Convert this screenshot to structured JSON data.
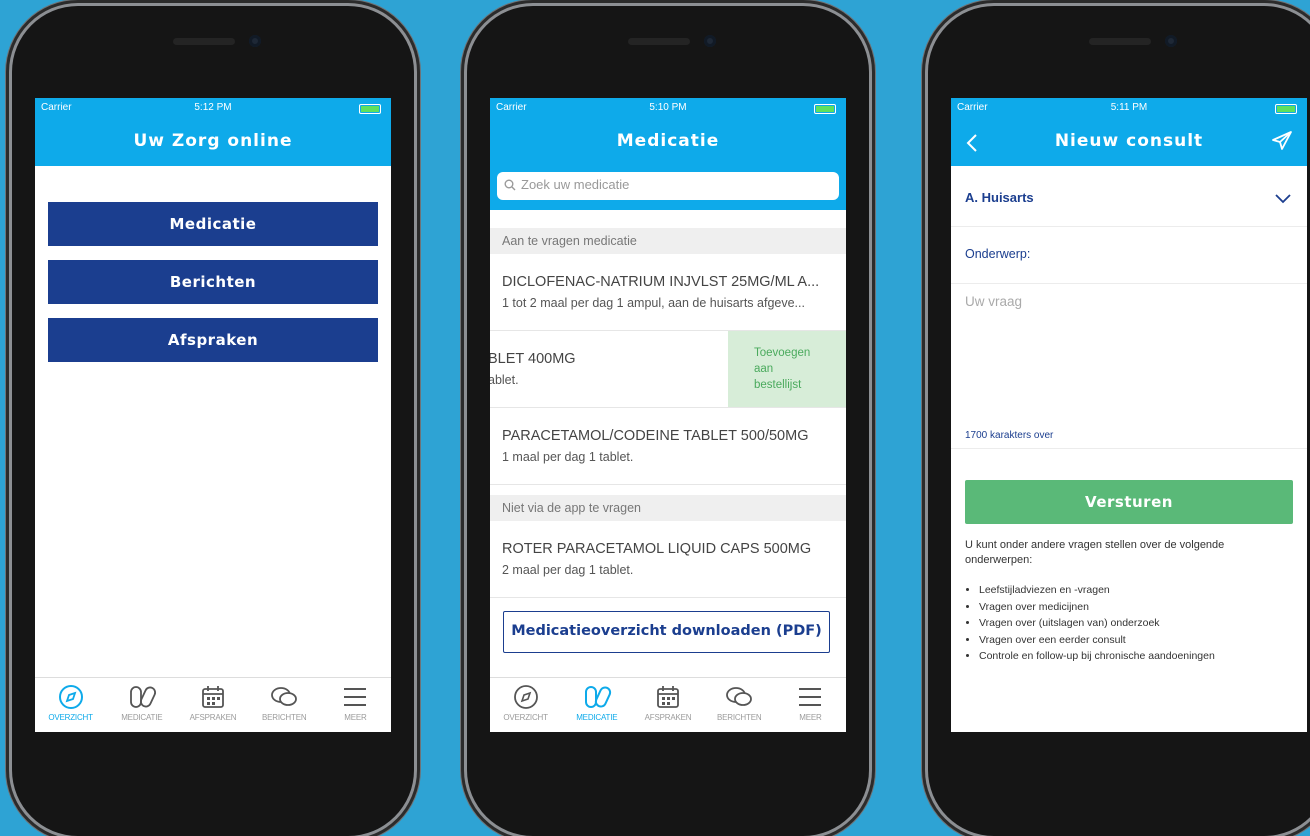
{
  "status": {
    "carrier": "Carrier",
    "times": [
      "5:12 PM",
      "5:10 PM",
      "5:11 PM"
    ]
  },
  "tabs": [
    "OVERZICHT",
    "MEDICATIE",
    "AFSPRAKEN",
    "BERICHTEN",
    "MEER"
  ],
  "colors": {
    "accent": "#0eaaea",
    "navy": "#1b3e8f",
    "green": "#5ab978",
    "background": "#2ea3d4"
  },
  "home": {
    "title": "Uw Zorg online",
    "buttons": [
      "Medicatie",
      "Berichten",
      "Afspraken"
    ],
    "active_tab": "OVERZICHT"
  },
  "medication": {
    "title": "Medicatie",
    "search_placeholder": "Zoek uw medicatie",
    "sections": [
      "Aan te vragen medicatie",
      "Niet via de app te vragen"
    ],
    "items": [
      {
        "name": "DICLOFENAC-NATRIUM INJVLST 25MG/ML A...",
        "dose": "1 tot 2 maal per dag 1 ampul, aan de huisarts afgeve..."
      },
      {
        "name": "BLET 400MG",
        "dose": "ablet."
      },
      {
        "name": "PARACETAMOL/CODEINE TABLET 500/50MG",
        "dose": "1 maal per dag 1 tablet."
      },
      {
        "name": "ROTER PARACETAMOL LIQUID CAPS 500MG",
        "dose": "2 maal per dag 1 tablet."
      }
    ],
    "swipe_action": [
      "Toevoegen",
      "aan",
      "bestellijst"
    ],
    "download_button": "Medicatieoverzicht downloaden (PDF)",
    "active_tab": "MEDICATIE"
  },
  "consult": {
    "title": "Nieuw consult",
    "recipient": "A. Huisarts",
    "subject_label": "Onderwerp:",
    "question_placeholder": "Uw vraag",
    "counter": "1700 karakters over",
    "send_button": "Versturen",
    "info_text": "U kunt onder andere vragen stellen over de volgende onderwerpen:",
    "topics": [
      "Leefstijladviezen en -vragen",
      "Vragen over medicijnen",
      "Vragen over (uitslagen van) onderzoek",
      "Vragen over een eerder consult",
      "Controle en follow-up bij chronische aandoeningen"
    ]
  }
}
